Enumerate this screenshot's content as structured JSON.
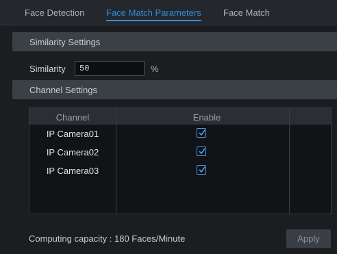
{
  "tabs": [
    {
      "label": "Face Detection"
    },
    {
      "label": "Face Match Parameters"
    },
    {
      "label": "Face Match"
    }
  ],
  "similarity_section": {
    "title": "Similarity Settings"
  },
  "similarity": {
    "label": "Similarity",
    "value": "50",
    "unit": "%"
  },
  "channel_section": {
    "title": "Channel Settings"
  },
  "table": {
    "headers": [
      "Channel",
      "Enable"
    ],
    "rows": [
      {
        "channel": "IP Camera01",
        "enabled": true
      },
      {
        "channel": "IP Camera02",
        "enabled": true
      },
      {
        "channel": "IP Camera03",
        "enabled": true
      }
    ]
  },
  "footer": {
    "capacity": "Computing capacity : 180 Faces/Minute"
  },
  "apply_label": "Apply",
  "colors": {
    "accent": "#2e8fe0",
    "background": "#1b1d21",
    "section_bar": "#3b3f46"
  }
}
